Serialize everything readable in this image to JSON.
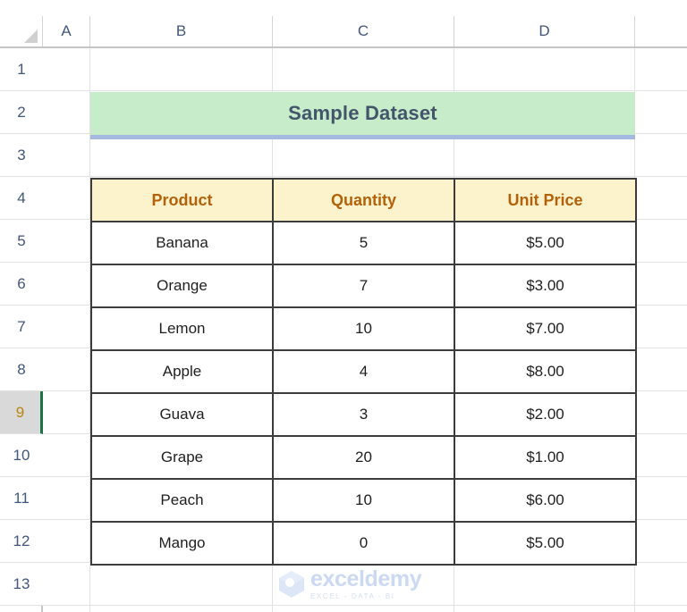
{
  "spreadsheet": {
    "column_headers": [
      "A",
      "B",
      "C",
      "D"
    ],
    "row_headers": [
      "1",
      "2",
      "3",
      "4",
      "5",
      "6",
      "7",
      "8",
      "9",
      "10",
      "11",
      "12",
      "13"
    ],
    "selected_row": "9",
    "select_all_icon": "select-all-triangle-icon"
  },
  "title": {
    "text": "Sample Dataset",
    "fill_color": "#c6ecca",
    "text_color": "#44546a",
    "underline_color": "#a5b8e0"
  },
  "table": {
    "headers": [
      "Product",
      "Quantity",
      "Unit Price"
    ],
    "header_fill": "#fcf3cd",
    "header_text_color": "#b3620a",
    "border_color": "#3c3c3c",
    "rows": [
      {
        "product": "Banana",
        "quantity": "5",
        "unit_price": "$5.00"
      },
      {
        "product": "Orange",
        "quantity": "7",
        "unit_price": "$3.00"
      },
      {
        "product": "Lemon",
        "quantity": "10",
        "unit_price": "$7.00"
      },
      {
        "product": "Apple",
        "quantity": "4",
        "unit_price": "$8.00"
      },
      {
        "product": "Guava",
        "quantity": "3",
        "unit_price": "$2.00"
      },
      {
        "product": "Grape",
        "quantity": "20",
        "unit_price": "$1.00"
      },
      {
        "product": "Peach",
        "quantity": "10",
        "unit_price": "$6.00"
      },
      {
        "product": "Mango",
        "quantity": "0",
        "unit_price": "$5.00"
      }
    ]
  },
  "watermark": {
    "name": "exceldemy",
    "tagline": "EXCEL - DATA - BI",
    "logo_icon": "exceldemy-cube-logo-icon",
    "color": "#ccd9f2"
  }
}
